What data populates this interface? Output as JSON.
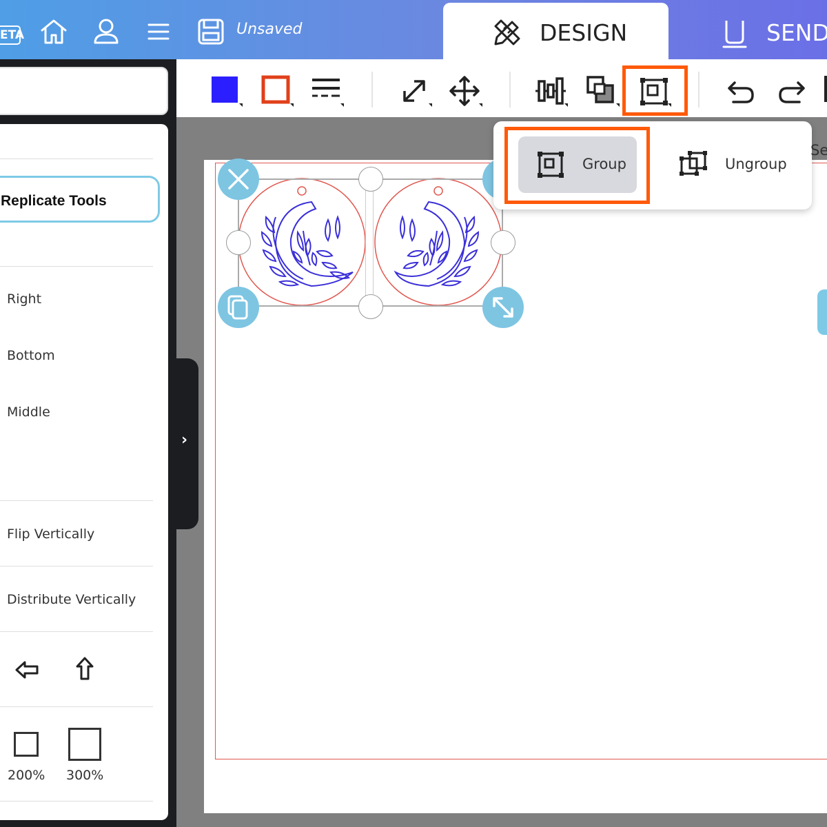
{
  "header": {
    "beta_label": "ETA",
    "status": "Unsaved",
    "tabs": [
      {
        "label": "DESIGN",
        "active": true
      },
      {
        "label": "SEND",
        "active": false
      }
    ]
  },
  "left_panel": {
    "replicate_label": "Replicate Tools",
    "align_items": [
      "Right",
      "Bottom",
      "Middle"
    ],
    "flip_label": "Flip Vertically",
    "distribute_label": "Distribute Vertically",
    "zoom_options": [
      "200%",
      "300%"
    ],
    "collapse_glyph": "›"
  },
  "toolbar": {
    "fill_color": "#2b1fff",
    "stroke_color": "#e0401a",
    "highlight_color": "#ff5a0a"
  },
  "dropdown": {
    "group_label": "Group",
    "ungroup_label": "Ungroup",
    "cut_off_label": "Se"
  },
  "canvas": {
    "design_color": "#3a2fd8",
    "cut_line_color": "#e0574f"
  }
}
